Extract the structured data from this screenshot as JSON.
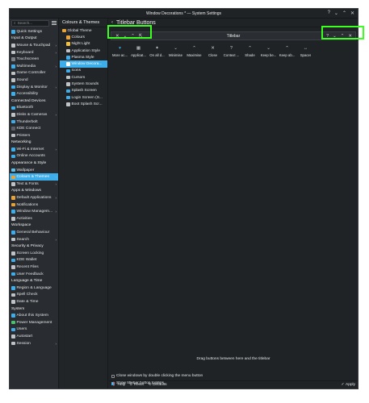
{
  "window": {
    "title": "Window Decorations * — System Settings",
    "controls": [
      "?",
      "⌄",
      "⌃",
      "✕"
    ]
  },
  "sidebar": {
    "search_placeholder": "Search...",
    "items": [
      {
        "type": "item",
        "label": "Quick Settings",
        "icon": "quick-settings-icon",
        "color": "#3daee9"
      },
      {
        "type": "header",
        "label": "Input & Output"
      },
      {
        "type": "item",
        "label": "Mouse & Touchpad",
        "icon": "mouse-icon",
        "color": "#bfc3c6",
        "chevron": true
      },
      {
        "type": "item",
        "label": "Keyboard",
        "icon": "keyboard-icon",
        "color": "#bfc3c6",
        "chevron": true
      },
      {
        "type": "item",
        "label": "Touchscreen",
        "icon": "touchscreen-icon",
        "color": "#7c8287"
      },
      {
        "type": "item",
        "label": "Multimedia",
        "icon": "multimedia-icon",
        "color": "#3daee9",
        "chevron": true
      },
      {
        "type": "item",
        "label": "Game Controller",
        "icon": "gamepad-icon",
        "color": "#bfc3c6"
      },
      {
        "type": "item",
        "label": "Sound",
        "icon": "sound-icon",
        "color": "#bfc3c6"
      },
      {
        "type": "item",
        "label": "Display & Monitor",
        "icon": "display-icon",
        "color": "#3daee9",
        "chevron": true
      },
      {
        "type": "item",
        "label": "Accessibility",
        "icon": "accessibility-icon",
        "color": "#3daee9"
      },
      {
        "type": "header",
        "label": "Connected Devices"
      },
      {
        "type": "item",
        "label": "Bluetooth",
        "icon": "bluetooth-icon",
        "color": "#3daee9"
      },
      {
        "type": "item",
        "label": "Disks & Cameras",
        "icon": "disks-icon",
        "color": "#bfc3c6",
        "chevron": true
      },
      {
        "type": "item",
        "label": "Thunderbolt",
        "icon": "thunderbolt-icon",
        "color": "#3daee9"
      },
      {
        "type": "item",
        "label": "KDE Connect",
        "icon": "kde-connect-icon",
        "color": "#5a6064"
      },
      {
        "type": "item",
        "label": "Printers",
        "icon": "printer-icon",
        "color": "#bfc3c6"
      },
      {
        "type": "header",
        "label": "Networking"
      },
      {
        "type": "item",
        "label": "Wi-Fi & Internet",
        "icon": "wifi-icon",
        "color": "#3daee9",
        "chevron": true
      },
      {
        "type": "item",
        "label": "Online Accounts",
        "icon": "online-accounts-icon",
        "color": "#3daee9"
      },
      {
        "type": "header",
        "label": "Appearance & Style"
      },
      {
        "type": "item",
        "label": "Wallpaper",
        "icon": "wallpaper-icon",
        "color": "#5bc0eb"
      },
      {
        "type": "item",
        "label": "Colours & Themes",
        "icon": "themes-icon",
        "color": "#e8a23a",
        "chevron": true,
        "active": true
      },
      {
        "type": "item",
        "label": "Text & Fonts",
        "icon": "fonts-icon",
        "color": "#bfc3c6",
        "chevron": true
      },
      {
        "type": "header",
        "label": "Apps & Windows"
      },
      {
        "type": "item",
        "label": "Default Applications",
        "icon": "default-apps-icon",
        "color": "#e8a23a",
        "chevron": true
      },
      {
        "type": "item",
        "label": "Notifications",
        "icon": "notifications-icon",
        "color": "#e8a23a"
      },
      {
        "type": "item",
        "label": "Window Managem...",
        "icon": "window-management-icon",
        "color": "#3daee9",
        "chevron": true
      },
      {
        "type": "item",
        "label": "Activities",
        "icon": "activities-icon",
        "color": "#bfc3c6"
      },
      {
        "type": "header",
        "label": "Workspace"
      },
      {
        "type": "item",
        "label": "General Behaviour",
        "icon": "general-behaviour-icon",
        "color": "#3daee9"
      },
      {
        "type": "item",
        "label": "Search",
        "icon": "search-icon",
        "color": "#bfc3c6",
        "chevron": true
      },
      {
        "type": "header",
        "label": "Security & Privacy"
      },
      {
        "type": "item",
        "label": "Screen Locking",
        "icon": "lock-icon",
        "color": "#bfc3c6"
      },
      {
        "type": "item",
        "label": "KDE Wallet",
        "icon": "wallet-icon",
        "color": "#3daee9"
      },
      {
        "type": "item",
        "label": "Recent Files",
        "icon": "recent-files-icon",
        "color": "#bfc3c6"
      },
      {
        "type": "item",
        "label": "User Feedback",
        "icon": "feedback-icon",
        "color": "#3daee9"
      },
      {
        "type": "header",
        "label": "Language & Time"
      },
      {
        "type": "item",
        "label": "Region & Language",
        "icon": "region-icon",
        "color": "#3daee9"
      },
      {
        "type": "item",
        "label": "Spell Check",
        "icon": "spellcheck-icon",
        "color": "#bfc3c6"
      },
      {
        "type": "item",
        "label": "Date & Time",
        "icon": "clock-icon",
        "color": "#bfc3c6"
      },
      {
        "type": "header",
        "label": "System"
      },
      {
        "type": "item",
        "label": "About this System",
        "icon": "about-icon",
        "color": "#3daee9"
      },
      {
        "type": "item",
        "label": "Power Management",
        "icon": "power-icon",
        "color": "#4cc26c"
      },
      {
        "type": "item",
        "label": "Users",
        "icon": "users-icon",
        "color": "#3daee9"
      },
      {
        "type": "item",
        "label": "Autostart",
        "icon": "autostart-icon",
        "color": "#bfc3c6"
      },
      {
        "type": "item",
        "label": "Session",
        "icon": "session-icon",
        "color": "#bfc3c6",
        "chevron": true
      }
    ]
  },
  "themes_panel": {
    "title": "Colours & Themes",
    "items": [
      {
        "label": "Global Theme",
        "icon": "global-theme-icon",
        "color": "#e8a23a",
        "sub": false
      },
      {
        "label": "Colours",
        "icon": "colours-icon",
        "color": "#e8a23a",
        "sub": true
      },
      {
        "label": "Night Light",
        "icon": "night-light-icon",
        "color": "#f0c040",
        "sub": true
      },
      {
        "label": "Application Style",
        "icon": "application-style-icon",
        "color": "#bfc3c6",
        "sub": true
      },
      {
        "label": "Plasma Style",
        "icon": "plasma-style-icon",
        "color": "#3daee9",
        "sub": true
      },
      {
        "label": "Window Decora...",
        "icon": "window-decorations-icon",
        "color": "#ffffff",
        "sub": true,
        "active": true
      },
      {
        "label": "Icons",
        "icon": "icons-icon",
        "color": "#3daee9",
        "sub": true
      },
      {
        "label": "Cursors",
        "icon": "cursors-icon",
        "color": "#bfc3c6",
        "sub": true
      },
      {
        "label": "System Sounds",
        "icon": "system-sounds-icon",
        "color": "#bfc3c6",
        "sub": true
      },
      {
        "label": "Splash Screen",
        "icon": "splash-screen-icon",
        "color": "#3daee9",
        "sub": true
      },
      {
        "label": "Login Screen (S...",
        "icon": "login-screen-icon",
        "color": "#3daee9",
        "sub": true
      },
      {
        "label": "Boot Splash Scr...",
        "icon": "boot-splash-icon",
        "color": "#bfc3c6",
        "sub": true
      }
    ]
  },
  "page": {
    "back_glyph": "‹",
    "title": "Titlebar Buttons",
    "preview": {
      "title": "Titlebar",
      "left_buttons": [
        {
          "glyph": "✕",
          "name": "close-icon"
        },
        {
          "glyph": "⌄",
          "name": "minimise-icon"
        },
        {
          "glyph": "⌃",
          "name": "maximise-icon"
        },
        {
          "glyph": "⇱",
          "name": "keep-above-icon"
        }
      ],
      "right_buttons": [
        {
          "glyph": "?",
          "name": "context-help-icon"
        },
        {
          "glyph": "⌄",
          "name": "minimise-icon"
        },
        {
          "glyph": "⌃",
          "name": "maximise-icon"
        },
        {
          "glyph": "✕",
          "name": "close-icon"
        }
      ]
    },
    "available_buttons": [
      {
        "label": "More ac...",
        "glyph": "▾",
        "name": "more-actions-icon",
        "color": "#3daee9"
      },
      {
        "label": "Applicat...",
        "glyph": "▦",
        "name": "application-menu-icon",
        "color": "#cfd2d4"
      },
      {
        "label": "On all d...",
        "glyph": "✦",
        "name": "on-all-desktops-icon",
        "color": "#cfd2d4"
      },
      {
        "label": "Minimise",
        "glyph": "⌄",
        "name": "minimise-icon",
        "color": "#cfd2d4"
      },
      {
        "label": "Maximise",
        "glyph": "⌃",
        "name": "maximise-icon",
        "color": "#cfd2d4"
      },
      {
        "label": "Close",
        "glyph": "✕",
        "name": "close-icon",
        "color": "#cfd2d4"
      },
      {
        "label": "Context ...",
        "glyph": "?",
        "name": "context-help-icon",
        "color": "#cfd2d4"
      },
      {
        "label": "Shade",
        "glyph": "⌃",
        "name": "shade-icon",
        "color": "#cfd2d4"
      },
      {
        "label": "Keep be...",
        "glyph": "⌄",
        "name": "keep-below-icon",
        "color": "#cfd2d4"
      },
      {
        "label": "Keep ab...",
        "glyph": "⌃",
        "name": "keep-above-icon",
        "color": "#cfd2d4"
      },
      {
        "label": "Spacer",
        "glyph": "↔",
        "name": "spacer-icon",
        "color": "#cfd2d4"
      }
    ],
    "hint": "Drag buttons between here and the titlebar",
    "checkbox_close_dblclick": {
      "label": "Close windows by double clicking the menu button",
      "checked": false
    },
    "checkbox_tooltips": {
      "label": "Show titlebar button tooltips",
      "checked": true
    }
  },
  "footer": {
    "help": "Help",
    "reset": "Reset",
    "defaults": "Defaults",
    "apply": "Apply"
  },
  "highlight_color": "#3cff22"
}
